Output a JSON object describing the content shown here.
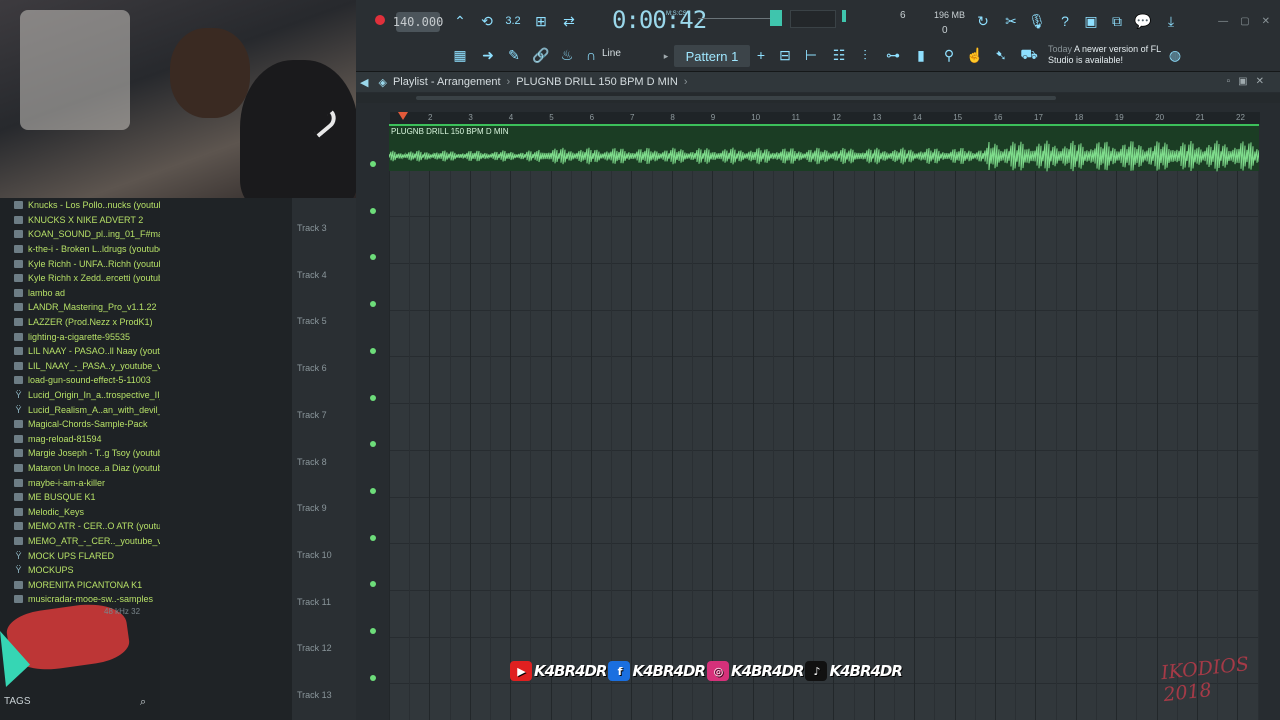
{
  "toolbar": {
    "tempo": "140.000",
    "time": "0:00:42",
    "time_unit": "M:S:CS",
    "cpu": "6",
    "memory": "196 MB",
    "memory_value": "0",
    "snap_mode": "Line",
    "pattern": "Pattern 1",
    "news_date": "Today",
    "news_text": "A newer version of FL Studio is available!",
    "step_label": "3.2"
  },
  "playlist": {
    "title": "Playlist - Arrangement",
    "arrangement": "PLUGNB DRILL 150 BPM D MIN",
    "clip_name": "PLUGNB DRILL 150 BPM D MIN",
    "ruler": [
      "2",
      "3",
      "4",
      "5",
      "6",
      "7",
      "8",
      "9",
      "10",
      "11",
      "12",
      "13",
      "14",
      "15",
      "16",
      "17",
      "18",
      "19",
      "20",
      "21",
      "22"
    ],
    "tracks": [
      "Track 3",
      "Track 4",
      "Track 5",
      "Track 6",
      "Track 7",
      "Track 8",
      "Track 9",
      "Track 10",
      "Track 11",
      "Track 12",
      "Track 13"
    ]
  },
  "browser": {
    "items": [
      {
        "label": "Knucks - Los Pollo..nucks (youtube)",
        "icon": "audio-file-icon"
      },
      {
        "label": "KNUCKS X NIKE ADVERT 2",
        "icon": "audio-file-icon"
      },
      {
        "label": "KOAN_SOUND_pl..ing_01_F#maj11",
        "icon": "audio-file-icon"
      },
      {
        "label": "k-the-i - Broken L..ldrugs (youtube)",
        "icon": "audio-file-icon"
      },
      {
        "label": "Kyle Richh - UNFA..Richh (youtube)",
        "icon": "audio-file-icon"
      },
      {
        "label": "Kyle Richh x Zedd..ercetti (youtube)",
        "icon": "audio-file-icon"
      },
      {
        "label": "lambo ad",
        "icon": "folder-icon"
      },
      {
        "label": "LANDR_Mastering_Pro_v1.1.22",
        "icon": "audio-file-icon"
      },
      {
        "label": "LAZZER (Prod.Nezz x ProdK1)",
        "icon": "audio-file-icon"
      },
      {
        "label": "lighting-a-cigarette-95535",
        "icon": "audio-file-icon"
      },
      {
        "label": "LIL NAAY - PASAO..ll Naay (youtube)",
        "icon": "audio-file-icon"
      },
      {
        "label": "LIL_NAAY_-_PASA..y_youtube_vocal",
        "icon": "audio-file-icon"
      },
      {
        "label": "load-gun-sound-effect-5-11003",
        "icon": "audio-file-icon"
      },
      {
        "label": "Lucid_Origin_In_a..trospective_II_0",
        "icon": "plugin-icon"
      },
      {
        "label": "Lucid_Realism_A..an_with_devil_1",
        "icon": "plugin-icon"
      },
      {
        "label": "Magical-Chords-Sample-Pack",
        "icon": "folder-icon"
      },
      {
        "label": "mag-reload-81594",
        "icon": "audio-file-icon"
      },
      {
        "label": "Margie Joseph - T..g Tsoy (youtube)",
        "icon": "audio-file-icon"
      },
      {
        "label": "Mataron Un Inoce..a Diaz (youtube)",
        "icon": "audio-file-icon"
      },
      {
        "label": "maybe-i-am-a-killer",
        "icon": "audio-file-icon"
      },
      {
        "label": "ME BUSQUE K1",
        "icon": "folder-icon"
      },
      {
        "label": "Melodic_Keys",
        "icon": "folder-icon"
      },
      {
        "label": "MEMO ATR - CER..O ATR (youtube)",
        "icon": "audio-file-icon"
      },
      {
        "label": "MEMO_ATR_-_CER.._youtube_vocal",
        "icon": "audio-file-icon"
      },
      {
        "label": "MOCK UPS FLARED",
        "icon": "plugin-icon"
      },
      {
        "label": "MOCKUPS",
        "icon": "plugin-icon"
      },
      {
        "label": "MORENITA PICANTONA K1",
        "icon": "folder-icon"
      },
      {
        "label": "musicradar-mooe-sw..-samples",
        "icon": "folder-icon"
      }
    ],
    "audio_info": "48 kHz 32",
    "tags_label": "TAGS"
  },
  "overlay": {
    "socials": [
      "K4BR4DR",
      "K4BR4DR",
      "K4BR4DR",
      "K4BR4DR"
    ],
    "signature": "IKODIOS 2018"
  },
  "colors": {
    "accent": "#8fe0ff",
    "browser_text": "#b6e067",
    "clip": "#3cc05a",
    "record": "#e0303b"
  }
}
